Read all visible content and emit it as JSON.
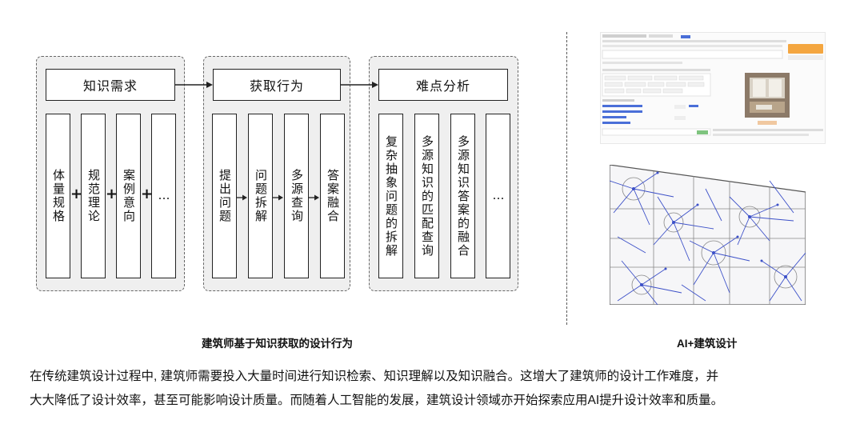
{
  "diagram": {
    "groups": [
      {
        "title": "知识需求",
        "columns": [
          "体量规格",
          "规范理论",
          "案例意向",
          "…"
        ],
        "separator": "+"
      },
      {
        "title": "获取行为",
        "columns": [
          "提出问题",
          "问题拆解",
          "多源查询",
          "答案融合"
        ]
      },
      {
        "title": "难点分析",
        "columns": [
          "复杂抽象问题的拆解",
          "多源知识的匹配查询",
          "多源知识答案的融合",
          "…"
        ]
      }
    ],
    "caption": "建筑师基于知识获取的设计行为"
  },
  "ai_panel": {
    "caption": "AI+建筑设计"
  },
  "paragraph": {
    "line1": "在传统建筑设计过程中, 建筑师需要投入大量时间进行知识检索、知识理解以及知识融合。这增大了建筑师的设计工作难度，并",
    "line2": "大大降低了设计效率，甚至可能影响设计质量。而随着人工智能的发展，建筑设计领域亦开始探索应用AI提升设计效率和质量。"
  },
  "colors": {
    "frame": "#222222",
    "group_bg": "#efefef",
    "plan_lines": "#3c50c8",
    "accent_button": "#f4a640"
  }
}
